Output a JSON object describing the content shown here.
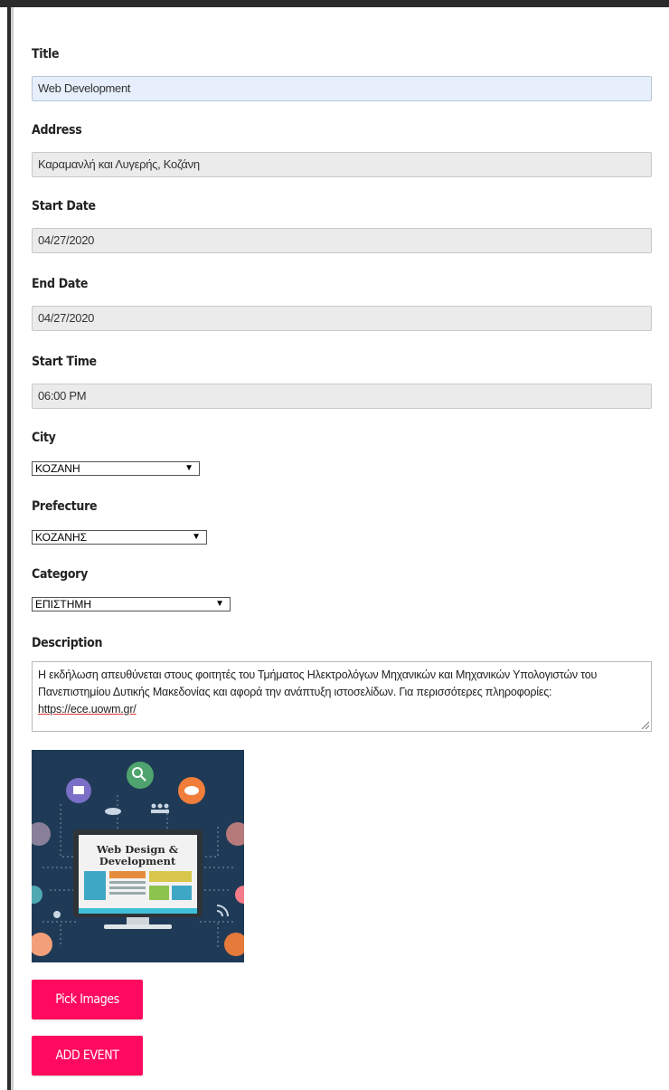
{
  "form": {
    "title": {
      "label": "Title",
      "value": "Web Development"
    },
    "address": {
      "label": "Address",
      "value": "Καραμανλή και Λυγερής, Κοζάνη"
    },
    "start_date": {
      "label": "Start Date",
      "value": "04/27/2020"
    },
    "end_date": {
      "label": "End Date",
      "value": "04/27/2020"
    },
    "start_time": {
      "label": "Start Time",
      "value": "06:00 PM"
    },
    "city": {
      "label": "City",
      "selected": "ΚΟΖΑΝΗ"
    },
    "prefecture": {
      "label": "Prefecture",
      "selected": "ΚΟΖΑΝΗΣ"
    },
    "category": {
      "label": "Category",
      "selected": "ΕΠΙΣΤΗΜΗ"
    },
    "description": {
      "label": "Description",
      "text": "Η εκδήλωση απευθύνεται στους φοιτητές του Τμήματος Ηλεκτρολόγων Μηχανικών και Μηχανικών Υπολογιστών του Πανεπιστημίου Δυτικής Μακεδονίας και αφορά την ανάπτυξη ιστοσελίδων. Για περισσότερες πληροφορίες:",
      "link": "https://ece.uowm.gr/"
    },
    "image": {
      "caption_line1": "Web Design &",
      "caption_line2": "Development"
    },
    "pick_images_label": "Pick Images",
    "add_event_label": "ADD EVENT"
  },
  "colors": {
    "accent": "#ff0a5f",
    "active_field": "#e6effb",
    "disabled_field": "#ebebeb",
    "image_background": "#1f3a56"
  }
}
